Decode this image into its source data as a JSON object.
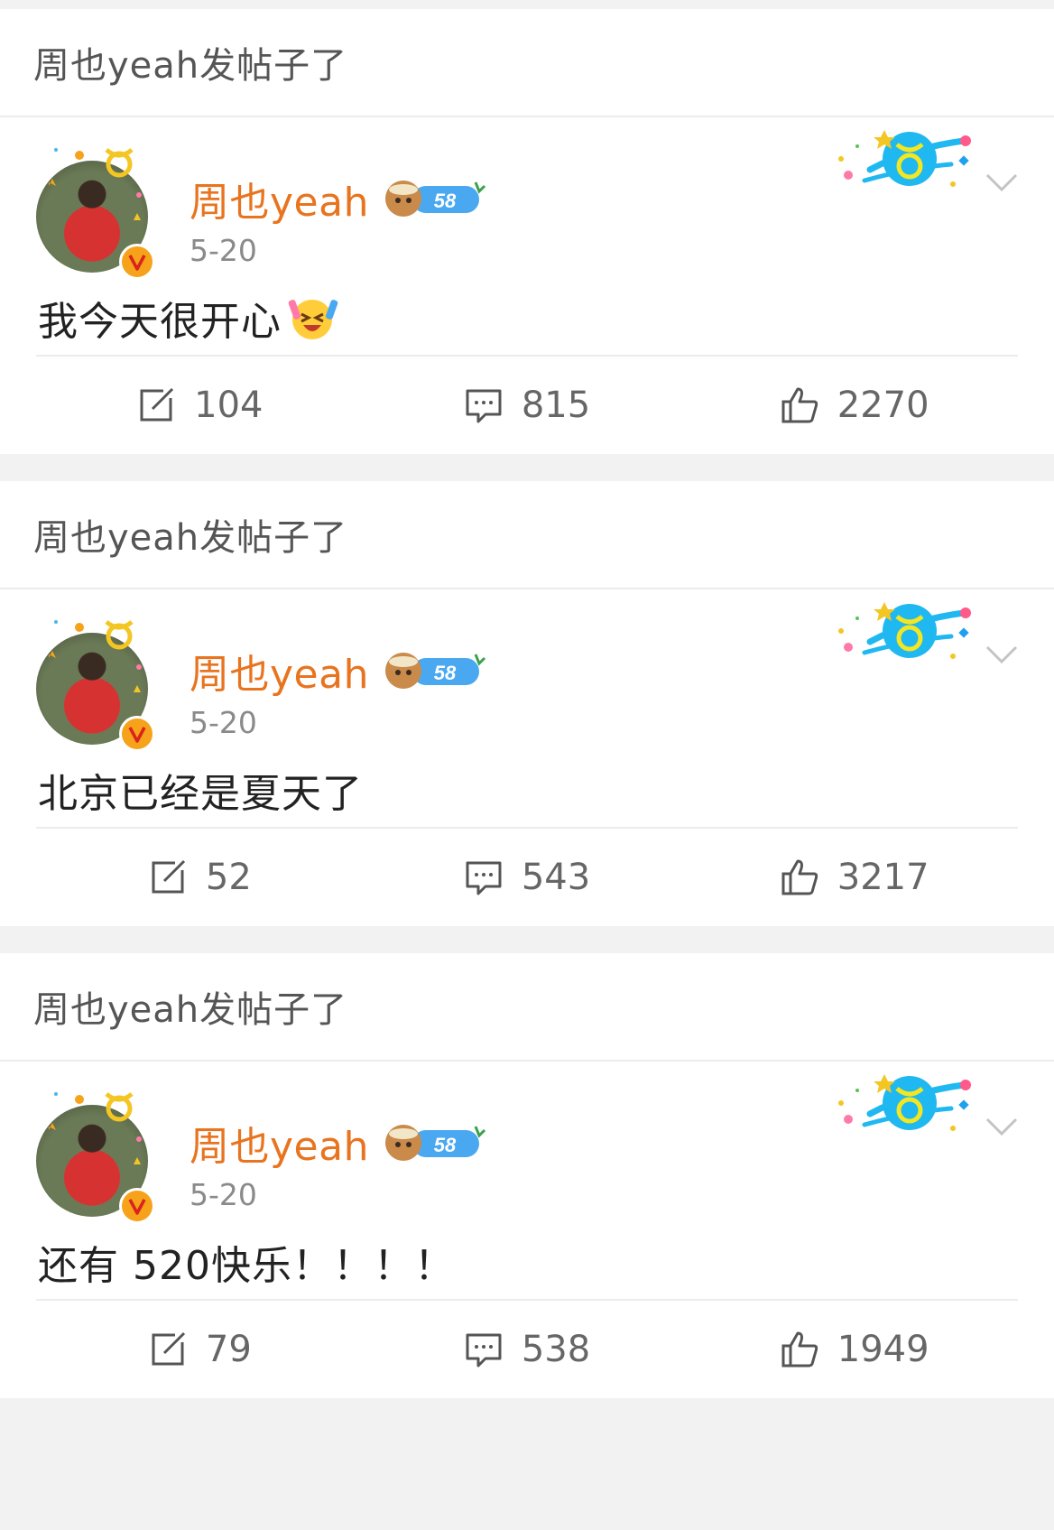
{
  "posts": [
    {
      "header": "周也yeah发帖子了",
      "username": "周也yeah",
      "level": "58",
      "time": "5-20",
      "text": "我今天很开心",
      "has_emoji": true,
      "reposts": "104",
      "comments": "815",
      "likes": "2270"
    },
    {
      "header": "周也yeah发帖子了",
      "username": "周也yeah",
      "level": "58",
      "time": "5-20",
      "text": "北京已经是夏天了",
      "has_emoji": false,
      "reposts": "52",
      "comments": "543",
      "likes": "3217"
    },
    {
      "header": "周也yeah发帖子了",
      "username": "周也yeah",
      "level": "58",
      "time": "5-20",
      "text": "还有 520快乐！！！！",
      "has_emoji": false,
      "reposts": "79",
      "comments": "538",
      "likes": "1949"
    }
  ],
  "icons": {
    "repost": "repost-icon",
    "comment": "comment-icon",
    "like": "thumbs-up-icon",
    "verified": "verified-v-icon",
    "expand": "chevron-down-icon",
    "badge_deco": "taurus-sticker-icon"
  },
  "colors": {
    "username": "#e8741f",
    "verified_badge": "#f6a21a",
    "background": "#f2f2f2"
  }
}
